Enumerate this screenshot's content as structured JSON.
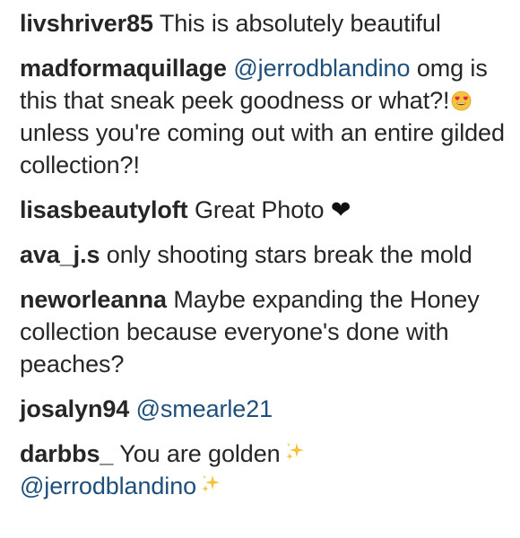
{
  "comments": [
    {
      "user": "livshriver85",
      "text": "This is absolutely beautiful"
    },
    {
      "user": "madformaquillage",
      "mention": "@jerrodblandino",
      "text_a": "omg is this that sneak peek goodness or what?!",
      "emoji": "heart-eyes-emoji",
      "text_b": "unless you're coming out with an entire gilded collection?!"
    },
    {
      "user": "lisasbeautyloft",
      "text": "Great Photo",
      "heart": "❤"
    },
    {
      "user": "ava_j.s",
      "text": "only shooting stars break the mold"
    },
    {
      "user": "neworleanna",
      "text": "Maybe expanding the Honey collection because everyone's done with peaches?"
    },
    {
      "user": "josalyn94",
      "mention": "@smearle21"
    },
    {
      "user": "darbbs_",
      "text": "You are golden",
      "mention": "@jerrodblandino",
      "emoji": "sparkles-emoji"
    }
  ]
}
